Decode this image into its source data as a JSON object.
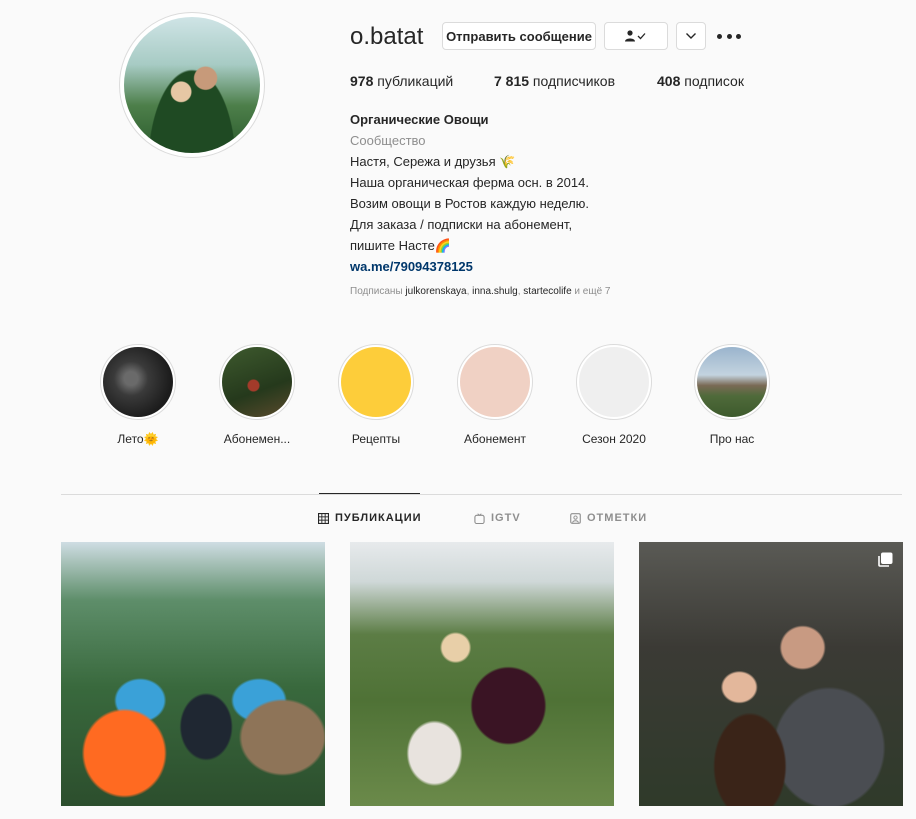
{
  "profile": {
    "username": "o.batat",
    "message_button": "Отправить сообщение",
    "follow_button_icon": "user-check-icon",
    "dropdown_icon": "chevron-down-icon",
    "more_icon": "more-dots-icon"
  },
  "stats": {
    "posts_count": "978",
    "posts_label": " публикаций",
    "followers_count": "7 815",
    "followers_label": " подписчиков",
    "following_count": "408",
    "following_label": " подписок"
  },
  "bio": {
    "full_name": "Органические Овощи",
    "category": "Сообщество",
    "lines": [
      "Настя, Сережа и друзья 🌾",
      "Наша органическая ферма осн. в 2014.",
      "Возим овощи в Ростов каждую неделю.",
      "Для заказа / подписки на абонемент,",
      "пишите Насте🌈"
    ],
    "link": "wa.me/79094378125"
  },
  "followed_by": {
    "prefix": "Подписаны ",
    "accounts": [
      "julkorenskaya",
      "inna.shulg",
      "startecolife"
    ],
    "suffix": " и ещё 7"
  },
  "highlights": [
    {
      "label": "Лето🌞"
    },
    {
      "label": "Абонемен..."
    },
    {
      "label": "Рецепты"
    },
    {
      "label": "Абонемент"
    },
    {
      "label": "Сезон 2020"
    },
    {
      "label": "Про нас"
    }
  ],
  "tabs": [
    {
      "label": "ПУБЛИКАЦИИ",
      "icon": "grid-icon",
      "active": true
    },
    {
      "label": "IGTV",
      "icon": "igtv-icon",
      "active": false
    },
    {
      "label": "ОТМЕТКИ",
      "icon": "tag-icon",
      "active": false
    }
  ],
  "posts": [
    {
      "kind": "photo"
    },
    {
      "kind": "photo"
    },
    {
      "kind": "carousel",
      "icon": "carousel-icon"
    }
  ],
  "colors": {
    "text": "#262626",
    "muted": "#8e8e8e",
    "link": "#00376b",
    "border": "#dbdbdb",
    "background": "#fafafa"
  }
}
